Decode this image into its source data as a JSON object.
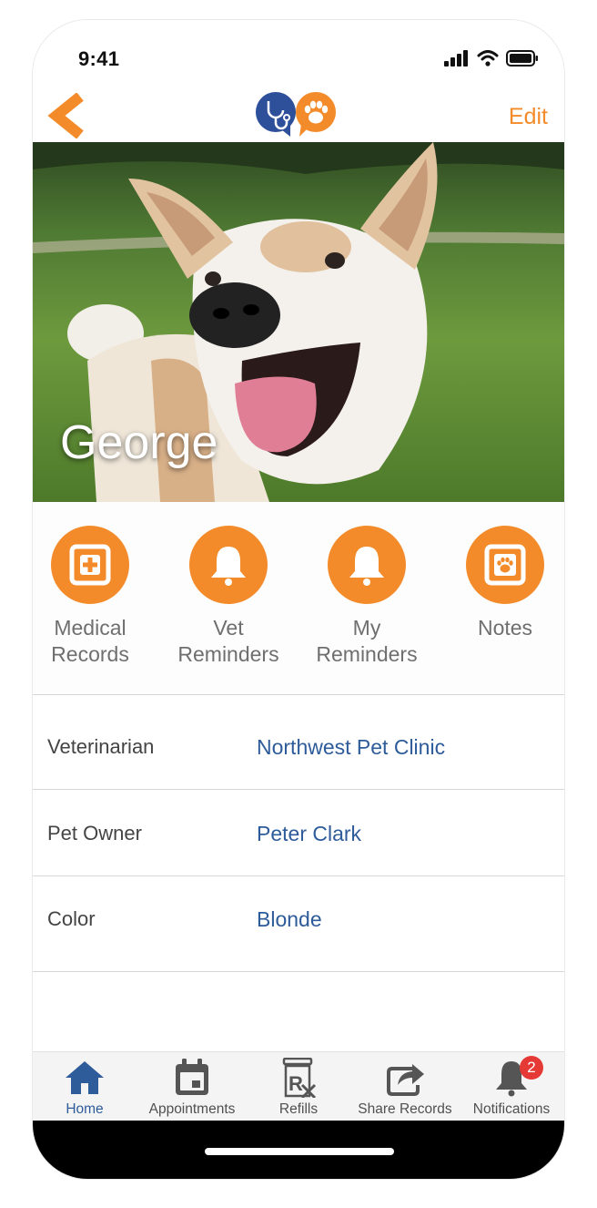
{
  "status_bar": {
    "time": "9:41"
  },
  "header": {
    "edit_label": "Edit",
    "accent_color": "#f48b2a"
  },
  "pet": {
    "name": "George"
  },
  "actions": [
    {
      "label_line1": "Medical",
      "label_line2": "Records",
      "icon": "medical-plus-icon"
    },
    {
      "label_line1": "Vet",
      "label_line2": "Reminders",
      "icon": "bell-icon"
    },
    {
      "label_line1": "My",
      "label_line2": "Reminders",
      "icon": "bell-icon"
    },
    {
      "label_line1": "Notes",
      "label_line2": "",
      "icon": "paw-note-icon"
    }
  ],
  "details": [
    {
      "key": "Veterinarian",
      "value": "Northwest Pet Clinic"
    },
    {
      "key": "Pet Owner",
      "value": "Peter Clark"
    },
    {
      "key": "Color",
      "value": "Blonde"
    }
  ],
  "tabs": [
    {
      "label": "Home",
      "icon": "home-icon",
      "active": true
    },
    {
      "label": "Appointments",
      "icon": "calendar-icon"
    },
    {
      "label": "Refills",
      "icon": "prescription-icon"
    },
    {
      "label": "Share Records",
      "icon": "share-icon"
    },
    {
      "label": "Notifications",
      "icon": "bell-icon",
      "badge": "2"
    }
  ],
  "colors": {
    "link": "#2e5b9a",
    "tab_active": "#2e5b9a",
    "badge": "#e53935",
    "logo_blue": "#2e4f9a"
  }
}
